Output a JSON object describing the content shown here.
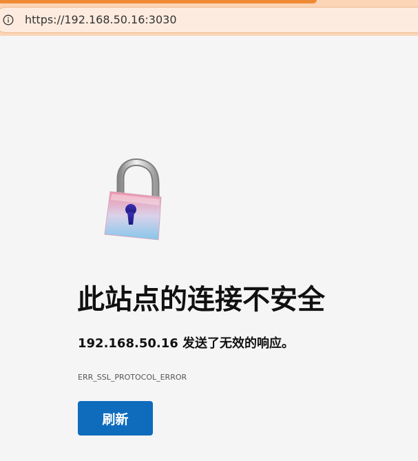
{
  "browser": {
    "url": "https://192.168.50.16:3030",
    "address_icon": "info-icon"
  },
  "error": {
    "illustration_icon": "unlocked-padlock-icon",
    "heading": "此站点的连接不安全",
    "description": "192.168.50.16 发送了无效的响应。",
    "code": "ERR_SSL_PROTOCOL_ERROR",
    "refresh_label": "刷新"
  },
  "colors": {
    "accent": "#0f6cbd",
    "toolbar_bg": "#fbd5b5",
    "toolbar_strip": "#f08b35",
    "page_bg": "#f5f5f5"
  }
}
